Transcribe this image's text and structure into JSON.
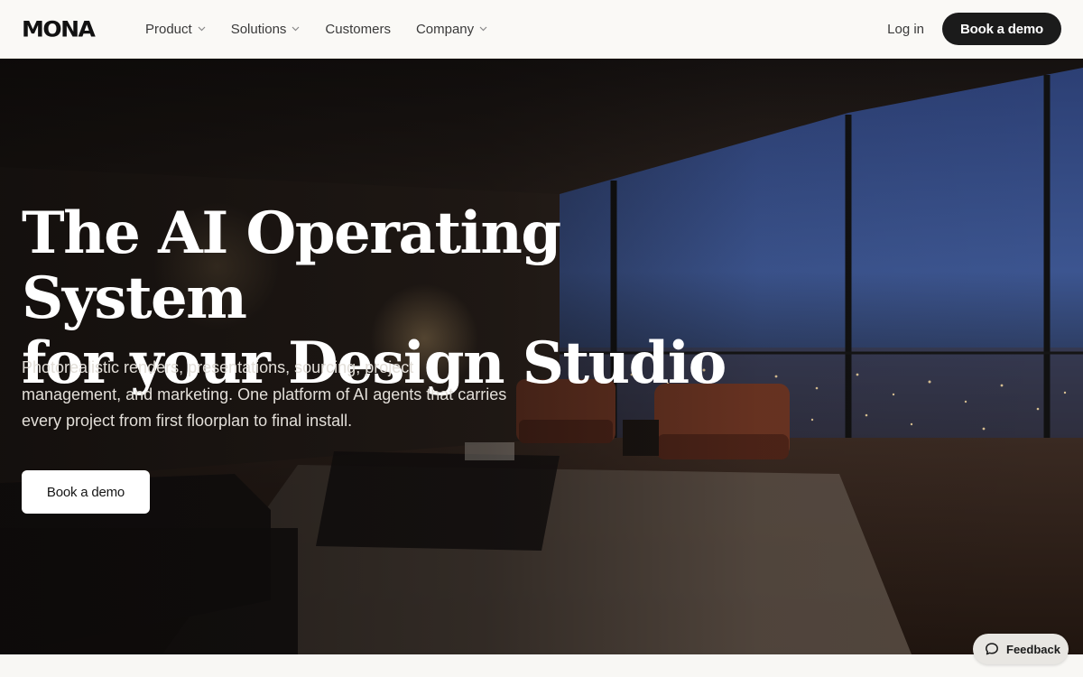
{
  "header": {
    "logo": "MONA",
    "nav": [
      {
        "label": "Product",
        "has_dropdown": true
      },
      {
        "label": "Solutions",
        "has_dropdown": true
      },
      {
        "label": "Customers",
        "has_dropdown": false
      },
      {
        "label": "Company",
        "has_dropdown": true
      }
    ],
    "login_label": "Log in",
    "cta_label": "Book a demo"
  },
  "hero": {
    "headline_line1": "The AI Operating System",
    "headline_line2": "for your Design Studio",
    "subhead_line1": "Photorealistic renders, presentations, sourcing, project",
    "subhead_line2": "management, and marketing. One platform of AI agents that carries",
    "subhead_line3": "every project from first floorplan to final install.",
    "cta_label": "Book a demo",
    "background_image": "night-city-penthouse-living-room"
  },
  "feedback": {
    "label": "Feedback",
    "icon": "chat-bubble-icon"
  },
  "colors": {
    "header_bg": "#faf9f6",
    "dark_button": "#1b1b1b",
    "hero_text": "#ffffff",
    "subhead_text": "#e2ded8"
  }
}
